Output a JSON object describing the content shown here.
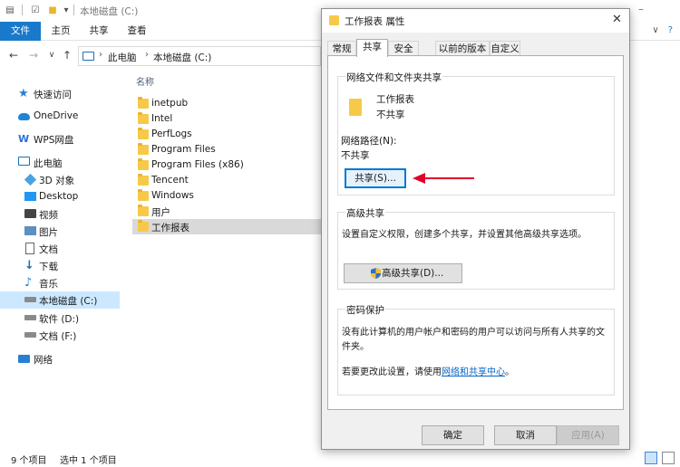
{
  "explorer": {
    "title": "本地磁盘 (C:)",
    "ribbon_tabs": [
      "文件",
      "主页",
      "共享",
      "查看"
    ],
    "breadcrumb": [
      "此电脑",
      "本地磁盘 (C:)"
    ],
    "nav": [
      {
        "label": "快速访问",
        "icon": "star-icon"
      },
      {
        "label": "OneDrive",
        "icon": "cloud-icon"
      },
      {
        "label": "WPS网盘",
        "icon": "wps-icon"
      },
      {
        "label": "此电脑",
        "icon": "pc-icon"
      },
      {
        "label": "3D 对象",
        "icon": "cube-icon"
      },
      {
        "label": "Desktop",
        "icon": "desktop-icon"
      },
      {
        "label": "视频",
        "icon": "video-icon"
      },
      {
        "label": "图片",
        "icon": "picture-icon"
      },
      {
        "label": "文档",
        "icon": "document-icon"
      },
      {
        "label": "下载",
        "icon": "download-icon"
      },
      {
        "label": "音乐",
        "icon": "music-icon"
      },
      {
        "label": "本地磁盘 (C:)",
        "icon": "drive-icon"
      },
      {
        "label": "软件 (D:)",
        "icon": "drive-icon"
      },
      {
        "label": "文档 (F:)",
        "icon": "drive-icon"
      },
      {
        "label": "网络",
        "icon": "network-icon"
      }
    ],
    "column_name": "名称",
    "files": [
      "inetpub",
      "Intel",
      "PerfLogs",
      "Program Files",
      "Program Files (x86)",
      "Tencent",
      "Windows",
      "用户",
      "工作报表"
    ],
    "status_count": "9 个项目",
    "status_selected": "选中 1 个项目"
  },
  "dialog": {
    "title": "工作报表 属性",
    "tabs": [
      "常规",
      "共享",
      "安全",
      "以前的版本",
      "自定义"
    ],
    "network_group_title": "网络文件和文件夹共享",
    "folder_name": "工作报表",
    "share_state": "不共享",
    "network_path_label": "网络路径(N):",
    "network_path_value": "不共享",
    "share_button": "共享(S)...",
    "advanced_group_title": "高级共享",
    "advanced_desc": "设置自定义权限，创建多个共享，并设置其他高级共享选项。",
    "advanced_button": "高级共享(D)...",
    "password_group_title": "密码保护",
    "password_desc": "没有此计算机的用户帐户和密码的用户可以访问与所有人共享的文件夹。",
    "password_change_prefix": "若要更改此设置，请使用",
    "password_link": "网络和共享中心",
    "password_change_suffix": "。",
    "ok_button": "确定",
    "cancel_button": "取消",
    "apply_button": "应用(A)"
  },
  "colors": {
    "accent": "#1979ca",
    "arrow": "#e0002b",
    "link": "#0066cc",
    "selection": "#cce8ff"
  }
}
